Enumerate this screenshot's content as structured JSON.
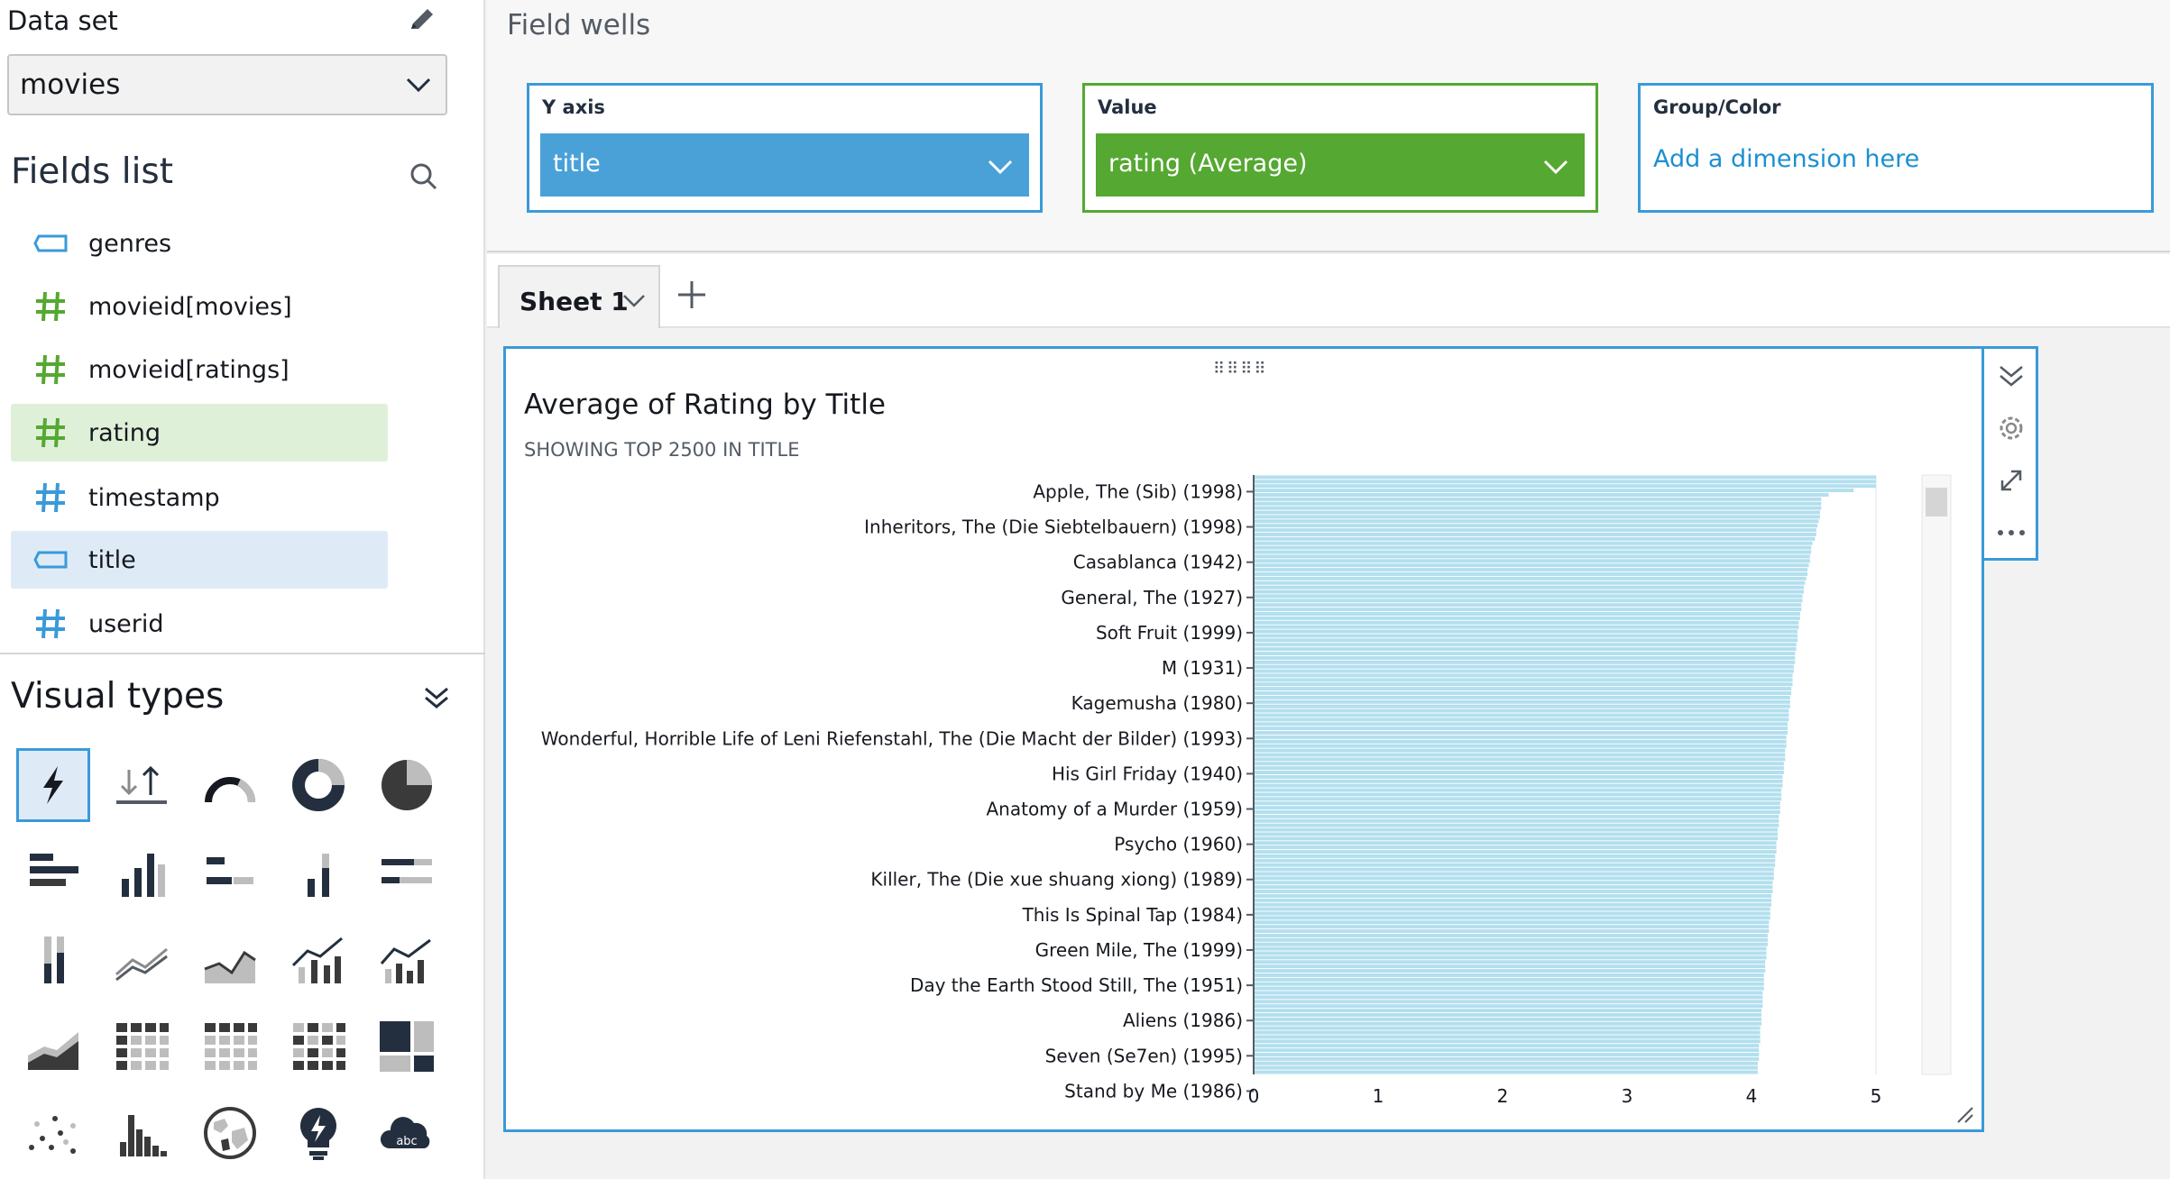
{
  "sidebar": {
    "dataset_title": "Data set",
    "dataset_value": "movies",
    "fields_title": "Fields list",
    "fields": [
      {
        "name": "genres",
        "type": "dimension",
        "selected": false
      },
      {
        "name": "movieid[movies]",
        "type": "measure",
        "selected": false
      },
      {
        "name": "movieid[ratings]",
        "type": "measure",
        "selected": false
      },
      {
        "name": "rating",
        "type": "measure",
        "selected": "green"
      },
      {
        "name": "timestamp",
        "type": "measure-blue",
        "selected": false
      },
      {
        "name": "title",
        "type": "dimension",
        "selected": "blue"
      },
      {
        "name": "userid",
        "type": "measure-blue",
        "selected": false
      }
    ],
    "visual_types_title": "Visual types"
  },
  "wells": {
    "title": "Field wells",
    "y_axis_label": "Y axis",
    "y_axis_value": "title",
    "value_label": "Value",
    "value_value": "rating (Average)",
    "group_label": "Group/Color",
    "group_placeholder": "Add a dimension here"
  },
  "tabs": {
    "sheet_label": "Sheet 1"
  },
  "visual": {
    "title": "Average of Rating by Title",
    "subtitle": "SHOWING TOP 2500 IN TITLE"
  },
  "colors": {
    "accent_blue": "#3a9ad9",
    "accent_green": "#55a831",
    "bar": "#b3dfee"
  },
  "chart_data": {
    "type": "bar",
    "orientation": "horizontal",
    "categories": [
      "Apple, The (Sib) (1998)",
      "Inheritors, The (Die Siebtelbauern) (1998)",
      "Casablanca (1942)",
      "General, The (1927)",
      "Soft Fruit (1999)",
      "M (1931)",
      "Kagemusha (1980)",
      "Wonderful, Horrible Life of Leni Riefenstahl, The (Die Macht der Bilder) (1993)",
      "His Girl Friday (1940)",
      "Anatomy of a Murder (1959)",
      "Psycho (1960)",
      "Killer, The (Die xue shuang xiong) (1989)",
      "This Is Spinal Tap (1984)",
      "Green Mile, The (1999)",
      "Day the Earth Stood Still, The (1951)",
      "Aliens (1986)",
      "Seven (Se7en) (1995)",
      "Stand by Me (1986)"
    ],
    "values": [
      5,
      5,
      5,
      4.82,
      4.62,
      4.56,
      4.56,
      4.56,
      4.55,
      4.55,
      4.54,
      4.53,
      4.52,
      4.52,
      4.51,
      4.49,
      4.48,
      4.48,
      4.47,
      4.47,
      4.46,
      4.45,
      4.45,
      4.44,
      4.43,
      4.42,
      4.42,
      4.41,
      4.41,
      4.4,
      4.4,
      4.39,
      4.39,
      4.38,
      4.38,
      4.37,
      4.37,
      4.37,
      4.36,
      4.36,
      4.35,
      4.35,
      4.35,
      4.34,
      4.34,
      4.33,
      4.33,
      4.33,
      4.32,
      4.32,
      4.31,
      4.31,
      4.31,
      4.3,
      4.3,
      4.3,
      4.29,
      4.29,
      4.29,
      4.28,
      4.28,
      4.28,
      4.27,
      4.27,
      4.27,
      4.26,
      4.26,
      4.26,
      4.25,
      4.25,
      4.25,
      4.24,
      4.24,
      4.24,
      4.23,
      4.23,
      4.23,
      4.22,
      4.22,
      4.22,
      4.21,
      4.21,
      4.21,
      4.2,
      4.2,
      4.2,
      4.19,
      4.19,
      4.19,
      4.18,
      4.18,
      4.18,
      4.17,
      4.17,
      4.17,
      4.16,
      4.16,
      4.16,
      4.15,
      4.15,
      4.15,
      4.14,
      4.14,
      4.14,
      4.13,
      4.13,
      4.13,
      4.12,
      4.12,
      4.12,
      4.11,
      4.11,
      4.11,
      4.1,
      4.1,
      4.1,
      4.1,
      4.09,
      4.09,
      4.09,
      4.09,
      4.08,
      4.08,
      4.08,
      4.08,
      4.07,
      4.07,
      4.07,
      4.07,
      4.06,
      4.06,
      4.06,
      4.06,
      4.05,
      4.05,
      4.05
    ],
    "label_every": 8,
    "xlim": [
      0,
      5
    ],
    "xticks": [
      0,
      1,
      2,
      3,
      4,
      5
    ],
    "xlabel": "",
    "ylabel": ""
  }
}
